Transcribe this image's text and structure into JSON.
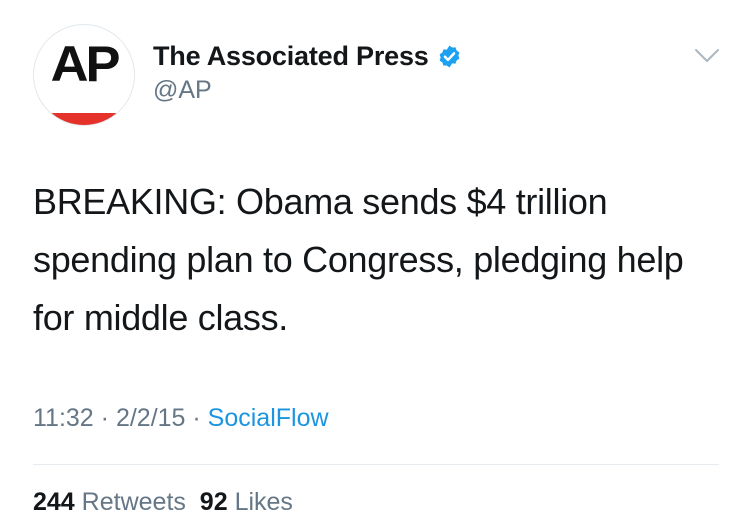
{
  "account": {
    "avatar_text": "AP",
    "display_name": "The Associated Press",
    "handle": "@AP",
    "verified": true
  },
  "icons": {
    "verified": "verified-badge-icon",
    "caret": "chevron-down-icon"
  },
  "colors": {
    "verified_blue": "#1da1f2",
    "link_blue": "#1b95e0",
    "secondary_text": "#657786",
    "primary_text": "#14171a",
    "ap_red": "#e4322b"
  },
  "tweet": {
    "text": "BREAKING: Obama sends $4 trillion spending plan to Congress, pledging help for middle class.",
    "time": "11:32",
    "separator": " · ",
    "date": "2/2/15",
    "source": "SocialFlow"
  },
  "stats": {
    "retweets_count": "244",
    "retweets_label": "Retweets",
    "likes_count": "92",
    "likes_label": "Likes"
  }
}
